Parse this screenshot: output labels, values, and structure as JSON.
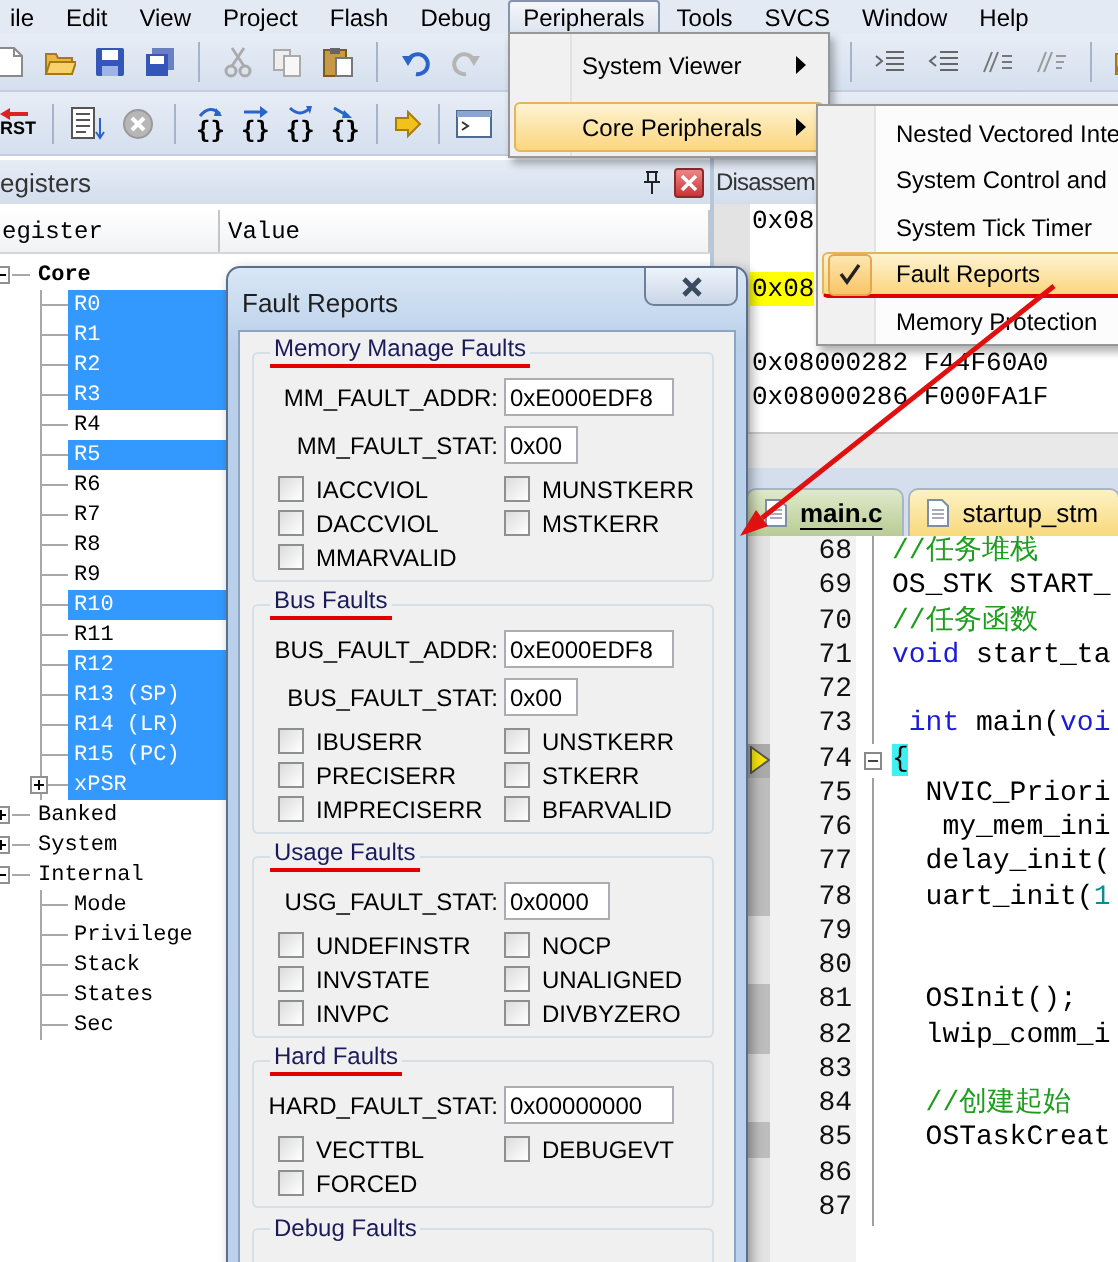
{
  "menu_bar": [
    {
      "label": "ile",
      "selected": false
    },
    {
      "label": "Edit",
      "selected": false
    },
    {
      "label": "View",
      "selected": false
    },
    {
      "label": "Project",
      "selected": false
    },
    {
      "label": "Flash",
      "selected": false
    },
    {
      "label": "Debug",
      "selected": false
    },
    {
      "label": "Peripherals",
      "selected": true
    },
    {
      "label": "Tools",
      "selected": false
    },
    {
      "label": "SVCS",
      "selected": false
    },
    {
      "label": "Window",
      "selected": false
    },
    {
      "label": "Help",
      "selected": false
    }
  ],
  "debug_toolbar": {
    "reset_label": "RST",
    "step_glyphs": [
      "{}",
      "{}",
      "{}",
      "{}"
    ]
  },
  "registers_pane": {
    "title": "egisters",
    "columns": [
      "egister",
      "Value"
    ],
    "tree": [
      {
        "label": "Core",
        "selected": false,
        "expanded": true,
        "children": [
          {
            "label": "R0",
            "selected": true
          },
          {
            "label": "R1",
            "selected": true
          },
          {
            "label": "R2",
            "selected": true
          },
          {
            "label": "R3",
            "selected": true
          },
          {
            "label": "R4",
            "selected": false
          },
          {
            "label": "R5",
            "selected": true
          },
          {
            "label": "R6",
            "selected": false
          },
          {
            "label": "R7",
            "selected": false
          },
          {
            "label": "R8",
            "selected": false
          },
          {
            "label": "R9",
            "selected": false
          },
          {
            "label": "R10",
            "selected": true
          },
          {
            "label": "R11",
            "selected": false
          },
          {
            "label": "R12",
            "selected": true
          },
          {
            "label": "R13 (SP)",
            "selected": true
          },
          {
            "label": "R14 (LR)",
            "selected": true
          },
          {
            "label": "R15 (PC)",
            "selected": true
          },
          {
            "label": "xPSR",
            "selected": true,
            "expanded": false
          }
        ]
      },
      {
        "label": "Banked",
        "selected": false,
        "expanded": false
      },
      {
        "label": "System",
        "selected": false,
        "expanded": false
      },
      {
        "label": "Internal",
        "selected": false,
        "expanded": true,
        "children": [
          {
            "label": "Mode",
            "selected": false
          },
          {
            "label": "Privilege",
            "selected": false
          },
          {
            "label": "Stack",
            "selected": false
          },
          {
            "label": "States",
            "selected": false
          },
          {
            "label": "Sec",
            "selected": false
          }
        ]
      }
    ]
  },
  "disassembly_pane": {
    "title": "Disassem",
    "lines": [
      {
        "text": "0x08",
        "current": false
      },
      {
        "text": "0x08",
        "current": true
      },
      {
        "text": "0x08000282 F44F60A0",
        "current": false
      },
      {
        "text": "0x08000286 F000FA1F",
        "current": false
      }
    ]
  },
  "editor": {
    "tabs": [
      {
        "label": "main.c",
        "selected": true
      },
      {
        "label": "startup_stm",
        "selected": false
      }
    ],
    "lines": [
      {
        "number": "68",
        "segments": [
          {
            "text": "//任务堆栈",
            "kind": "comment"
          }
        ]
      },
      {
        "number": "69",
        "segments": [
          {
            "text": "OS_STK START_",
            "kind": "plain"
          }
        ]
      },
      {
        "number": "70",
        "segments": [
          {
            "text": "//任务函数",
            "kind": "comment"
          }
        ]
      },
      {
        "number": "71",
        "segments": [
          {
            "text": "void",
            "kind": "keyword"
          },
          {
            "text": " start_ta",
            "kind": "plain"
          }
        ]
      },
      {
        "number": "72"
      },
      {
        "number": "73",
        "segments": [
          {
            "text": " int",
            "kind": "keyword"
          },
          {
            "text": " main(",
            "kind": "plain"
          },
          {
            "text": "voi",
            "kind": "keyword"
          }
        ]
      },
      {
        "number": "74",
        "current": true,
        "executable": true,
        "expanded": true,
        "segments": [
          {
            "text": "{",
            "kind": "brace"
          }
        ]
      },
      {
        "number": "75",
        "executable": true,
        "segments": [
          {
            "text": "  NVIC_Priori",
            "kind": "plain"
          }
        ]
      },
      {
        "number": "76",
        "executable": true,
        "segments": [
          {
            "text": "   my_mem_ini",
            "kind": "plain"
          }
        ]
      },
      {
        "number": "77",
        "executable": true,
        "segments": [
          {
            "text": "  delay_init(",
            "kind": "plain"
          }
        ]
      },
      {
        "number": "78",
        "executable": true,
        "segments": [
          {
            "text": "  uart_init(",
            "kind": "plain"
          },
          {
            "text": "1",
            "kind": "number"
          }
        ]
      },
      {
        "number": "79"
      },
      {
        "number": "80"
      },
      {
        "number": "81",
        "executable": true,
        "segments": [
          {
            "text": "  OSInit();",
            "kind": "plain"
          }
        ]
      },
      {
        "number": "82",
        "executable": true,
        "segments": [
          {
            "text": "  lwip_comm_i",
            "kind": "plain"
          }
        ]
      },
      {
        "number": "83"
      },
      {
        "number": "84",
        "segments": [
          {
            "text": "  //创建起始",
            "kind": "comment"
          }
        ]
      },
      {
        "number": "85",
        "executable": true,
        "segments": [
          {
            "text": "  OSTaskCreat",
            "kind": "plain"
          }
        ]
      },
      {
        "number": "86"
      },
      {
        "number": "87"
      }
    ]
  },
  "peripherals_menu": {
    "items": [
      {
        "label": "System Viewer",
        "selected": false,
        "submenu": true
      },
      {
        "label": "Core Peripherals",
        "selected": true,
        "submenu": true
      }
    ]
  },
  "core_peripherals_menu": {
    "items": [
      {
        "label": "Nested Vectored Inte",
        "selected": false,
        "checked": false
      },
      {
        "label": "System Control and",
        "selected": false,
        "checked": false
      },
      {
        "label": "System Tick Timer",
        "selected": false,
        "checked": false
      },
      {
        "label": "Fault Reports",
        "selected": true,
        "checked": true,
        "underlined": true
      },
      {
        "label": "Memory Protection",
        "selected": false,
        "checked": false
      }
    ]
  },
  "fault_reports_dialog": {
    "title": "Fault Reports",
    "groups": [
      {
        "title": "Memory Manage Faults",
        "underlined": true,
        "fields": [
          {
            "label": "MM_FAULT_ADDR:",
            "value": "0xE000EDF8"
          },
          {
            "label": "MM_FAULT_STAT:",
            "value": "0x00"
          }
        ],
        "flags": [
          {
            "label": "IACCVIOL",
            "checked": false
          },
          {
            "label": "MUNSTKERR",
            "checked": false
          },
          {
            "label": "DACCVIOL",
            "checked": false
          },
          {
            "label": "MSTKERR",
            "checked": false
          },
          {
            "label": "MMARVALID",
            "checked": false
          }
        ]
      },
      {
        "title": "Bus Faults",
        "underlined": true,
        "fields": [
          {
            "label": "BUS_FAULT_ADDR:",
            "value": "0xE000EDF8"
          },
          {
            "label": "BUS_FAULT_STAT:",
            "value": "0x00"
          }
        ],
        "flags": [
          {
            "label": "IBUSERR",
            "checked": false
          },
          {
            "label": "UNSTKERR",
            "checked": false
          },
          {
            "label": "PRECISERR",
            "checked": false
          },
          {
            "label": "STKERR",
            "checked": false
          },
          {
            "label": "IMPRECISERR",
            "checked": false
          },
          {
            "label": "BFARVALID",
            "checked": false
          }
        ]
      },
      {
        "title": "Usage Faults",
        "underlined": true,
        "fields": [
          {
            "label": "USG_FAULT_STAT:",
            "value": "0x0000"
          }
        ],
        "flags": [
          {
            "label": "UNDEFINSTR",
            "checked": false
          },
          {
            "label": "NOCP",
            "checked": false
          },
          {
            "label": "INVSTATE",
            "checked": false
          },
          {
            "label": "UNALIGNED",
            "checked": false
          },
          {
            "label": "INVPC",
            "checked": false
          },
          {
            "label": "DIVBYZERO",
            "checked": false
          }
        ]
      },
      {
        "title": "Hard Faults",
        "underlined": true,
        "fields": [
          {
            "label": "HARD_FAULT_STAT:",
            "value": "0x00000000"
          }
        ],
        "flags": [
          {
            "label": "VECTTBL",
            "checked": false
          },
          {
            "label": "DEBUGEVT",
            "checked": false
          },
          {
            "label": "FORCED",
            "checked": false
          }
        ]
      },
      {
        "title": "Debug Faults",
        "underlined": false
      }
    ]
  },
  "annotations": {
    "arrow": true
  }
}
